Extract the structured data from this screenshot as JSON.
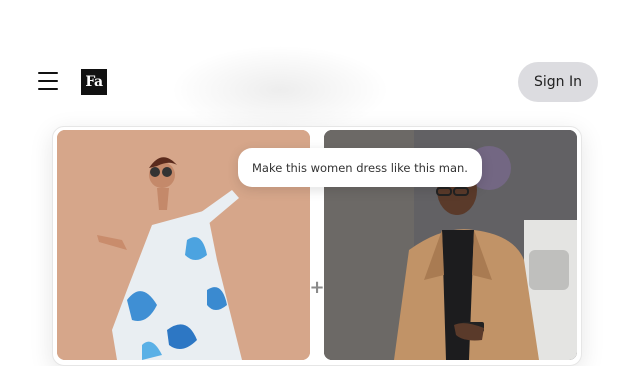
{
  "header": {
    "menu_icon": "hamburger-menu-icon",
    "logo_text": "Fa",
    "signin_label": "Sign In"
  },
  "demo": {
    "prompt_text": "Make this women dress like this man.",
    "join_symbol": "+",
    "left_image": "woman-in-floral-dress-photo",
    "right_image": "man-in-camel-coat-photo"
  },
  "colors": {
    "signin_bg": "#dcdce0",
    "logo_bg": "#111111",
    "left_photo_bg": "#d7a98a",
    "right_photo_bg": "#5a5a5d"
  }
}
